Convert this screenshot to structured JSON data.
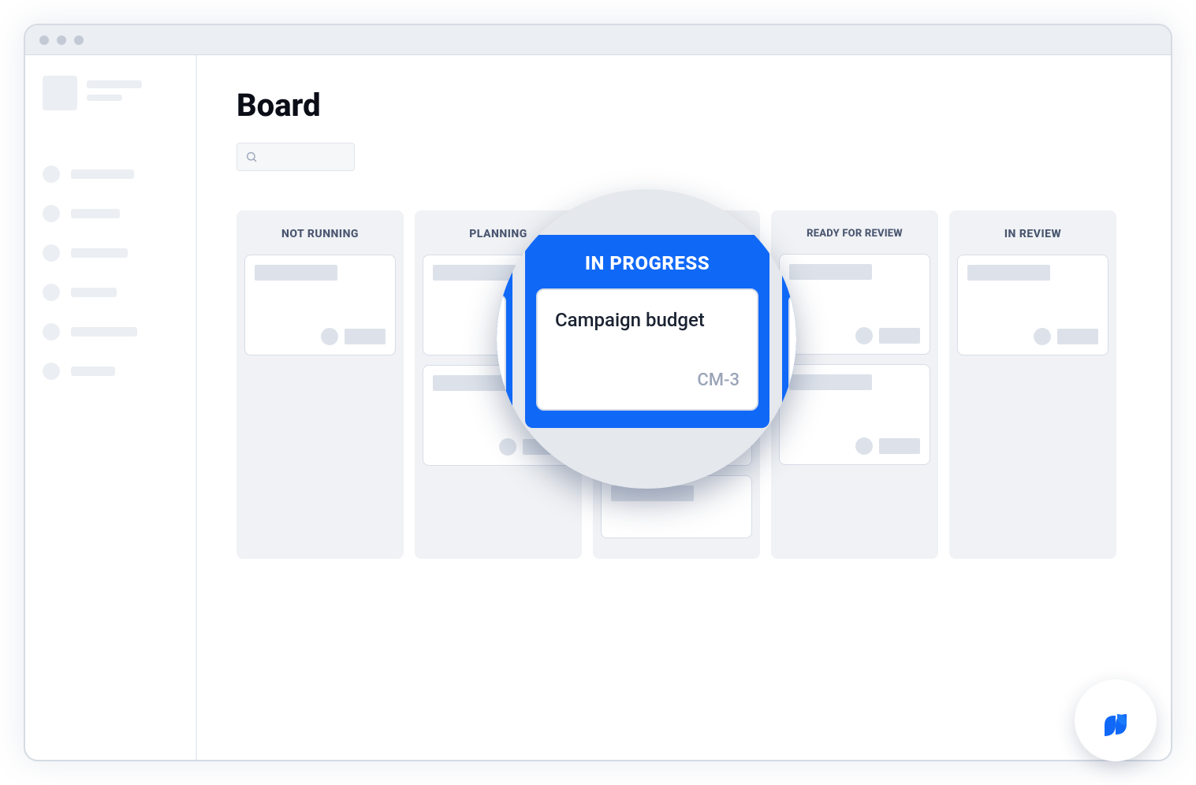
{
  "page": {
    "title": "Board"
  },
  "search": {
    "placeholder": ""
  },
  "columns": [
    {
      "header": "NOT RUNNING",
      "cards": 1
    },
    {
      "header": "PLANNING",
      "cards": 2
    },
    {
      "header": "IN PROGRESS",
      "cards": 3
    },
    {
      "header": "READY FOR REVIEW",
      "cards": 2
    },
    {
      "header": "IN REVIEW",
      "cards": 1
    }
  ],
  "magnifier": {
    "column_header": "IN PROGRESS",
    "card_title": "Campaign budget",
    "card_id": "CM-3",
    "right_partial": "R"
  },
  "sidebar": {
    "item_count": 6
  },
  "colors": {
    "accent": "#1068f7"
  }
}
